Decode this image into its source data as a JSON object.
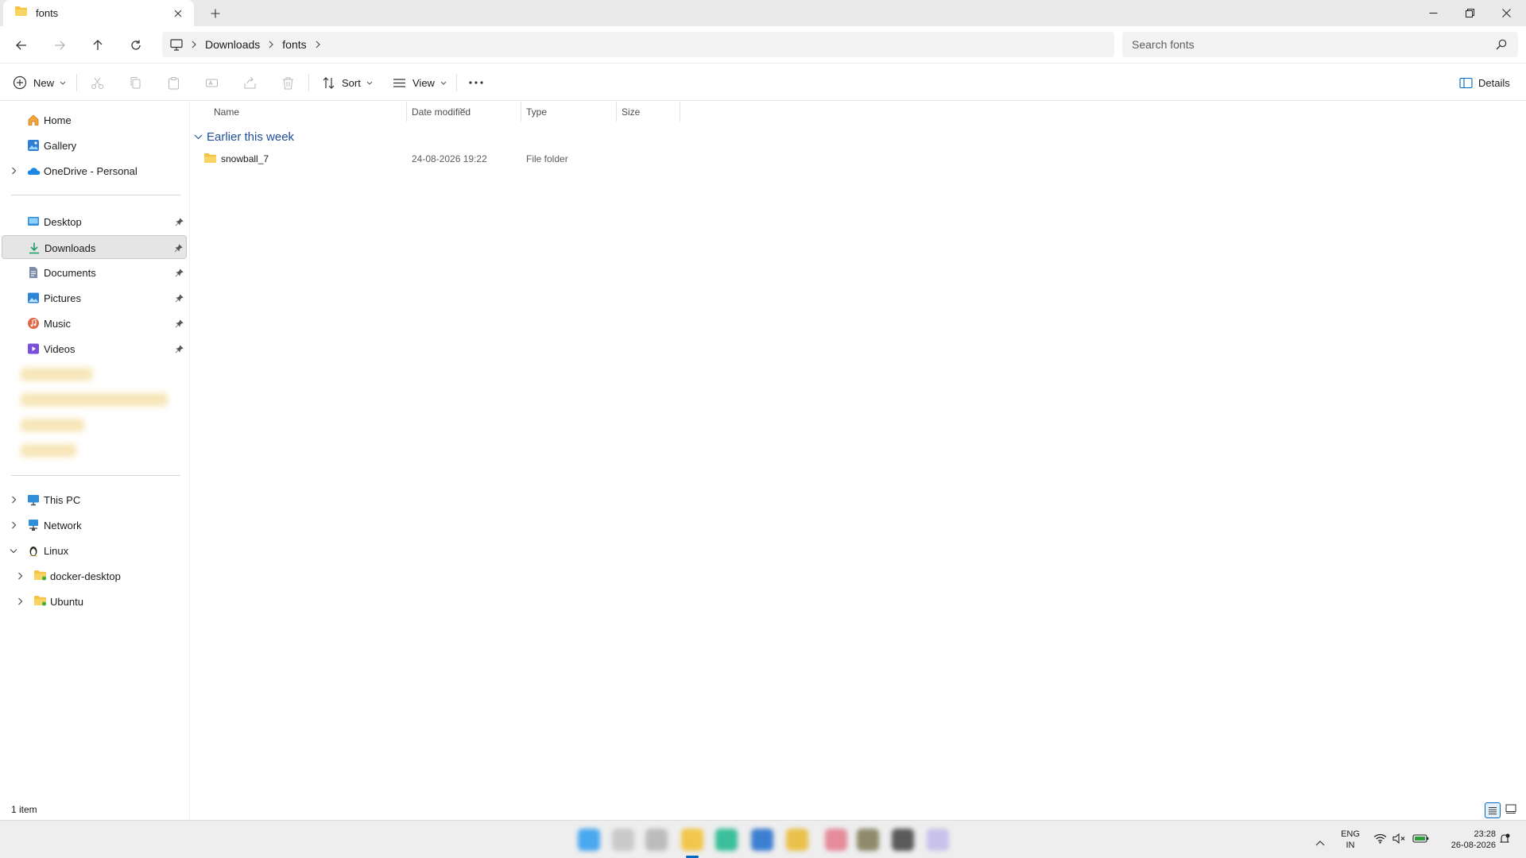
{
  "window": {
    "tab_title": "fonts",
    "new_tab": "+"
  },
  "address": {
    "crumbs": [
      "Downloads",
      "fonts"
    ],
    "search_placeholder": "Search fonts"
  },
  "toolbar": {
    "new_label": "New",
    "sort_label": "Sort",
    "view_label": "View",
    "details_label": "Details"
  },
  "nav": {
    "top": [
      {
        "label": "Home",
        "icon": "home-icon"
      },
      {
        "label": "Gallery",
        "icon": "gallery-icon"
      },
      {
        "label": "OneDrive - Personal",
        "icon": "onedrive-icon"
      }
    ],
    "quick": [
      {
        "label": "Desktop",
        "icon": "desktop-icon",
        "color": "#2f8fd8"
      },
      {
        "label": "Downloads",
        "icon": "download-icon",
        "color": "#1f9d6b"
      },
      {
        "label": "Documents",
        "icon": "documents-icon",
        "color": "#6b7b99"
      },
      {
        "label": "Pictures",
        "icon": "pictures-icon",
        "color": "#2d83d6"
      },
      {
        "label": "Music",
        "icon": "music-icon",
        "color": "#e0694a"
      },
      {
        "label": "Videos",
        "icon": "videos-icon",
        "color": "#7a4ed8"
      }
    ],
    "bottom": [
      {
        "label": "This PC",
        "icon": "pc-icon"
      },
      {
        "label": "Network",
        "icon": "network-icon"
      },
      {
        "label": "Linux",
        "icon": "linux-icon"
      },
      {
        "label": "docker-desktop",
        "icon": "folder-icon"
      },
      {
        "label": "Ubuntu",
        "icon": "folder-icon"
      }
    ]
  },
  "columns": [
    "Name",
    "Date modified",
    "Type",
    "Size"
  ],
  "group_label": "Earlier this week",
  "files": [
    {
      "name": "snowball_7",
      "date": "24-08-2026 19:22",
      "type": "File folder",
      "size": ""
    }
  ],
  "status": {
    "count": "1 item"
  },
  "tray": {
    "lang1": "ENG",
    "lang2": "IN",
    "time": "23:28",
    "date": "26-08-2026"
  },
  "colors": {
    "accent": "#0067c0",
    "folder": "#f5c342",
    "selected_bg": "#e5e5e5"
  }
}
